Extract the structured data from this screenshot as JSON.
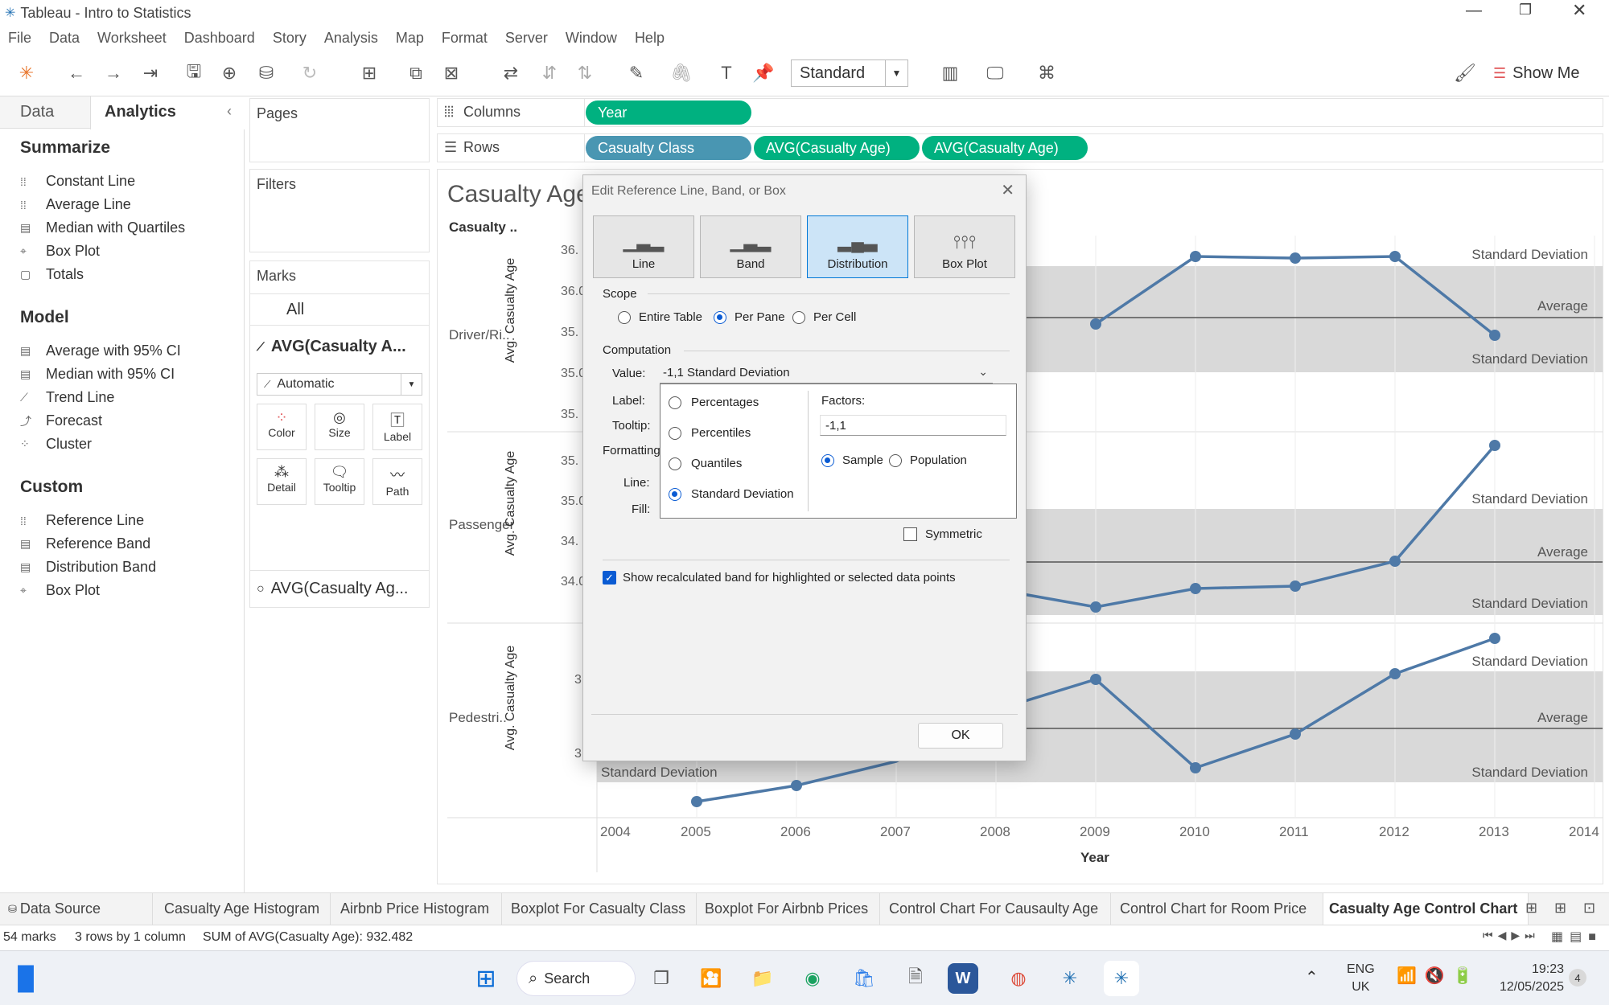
{
  "window": {
    "title": "Tableau - Intro to Statistics"
  },
  "menu": [
    "File",
    "Data",
    "Worksheet",
    "Dashboard",
    "Story",
    "Analysis",
    "Map",
    "Format",
    "Server",
    "Window",
    "Help"
  ],
  "toolbar": {
    "fit_select": "Standard",
    "show_me": "Show Me"
  },
  "left_pane": {
    "tab_data": "Data",
    "tab_analytics": "Analytics",
    "summarize": {
      "heading": "Summarize",
      "items": [
        "Constant Line",
        "Average Line",
        "Median with Quartiles",
        "Box Plot",
        "Totals"
      ]
    },
    "model": {
      "heading": "Model",
      "items": [
        "Average with 95% CI",
        "Median with 95% CI",
        "Trend Line",
        "Forecast",
        "Cluster"
      ]
    },
    "custom": {
      "heading": "Custom",
      "items": [
        "Reference Line",
        "Reference Band",
        "Distribution Band",
        "Box Plot"
      ]
    }
  },
  "cards": {
    "pages": "Pages",
    "filters": "Filters",
    "marks": "Marks",
    "marks_all": "All",
    "marks_measure1": "AVG(Casualty A...",
    "marks_type": "Automatic",
    "mark_buttons": [
      "Color",
      "Size",
      "Label",
      "Detail",
      "Tooltip",
      "Path"
    ],
    "marks_measure2": "AVG(Casualty Ag..."
  },
  "shelves": {
    "columns_label": "Columns",
    "rows_label": "Rows",
    "columns_pill": "Year",
    "rows_pills": [
      "Casualty Class",
      "AVG(Casualty Age)",
      "AVG(Casualty Age)"
    ]
  },
  "view": {
    "title": "Casualty Age",
    "header": "Casualty ..",
    "row_headers": [
      "Driver/Ri..",
      "Passenger",
      "Pedestri.."
    ],
    "axis_label": "Avg. Casualty Age",
    "ticks_pane1": [
      "36.",
      "36.0",
      "35.",
      "35.0",
      "35."
    ],
    "ticks_pane2": [
      "35.",
      "35.0",
      "34.",
      "34.0"
    ],
    "ticks_pane3": [
      "3",
      "3"
    ],
    "ref_std": "Standard Deviation",
    "ref_avg": "Average",
    "x_ticks": [
      "2004",
      "2005",
      "2006",
      "2007",
      "2008",
      "2009",
      "2010",
      "2011",
      "2012",
      "2013",
      "2014"
    ],
    "x_title": "Year"
  },
  "dialog": {
    "title": "Edit Reference Line, Band, or Box",
    "tabs": [
      "Line",
      "Band",
      "Distribution",
      "Box Plot"
    ],
    "scope_label": "Scope",
    "scope_options": [
      "Entire Table",
      "Per Pane",
      "Per Cell"
    ],
    "computation_label": "Computation",
    "value_label": "Value:",
    "value": "-1,1 Standard Deviation",
    "label_label": "Label:",
    "tooltip_label": "Tooltip:",
    "formatting_label": "Formatting",
    "line_label": "Line:",
    "fill_label": "Fill:",
    "dist_options": [
      "Percentages",
      "Percentiles",
      "Quantiles",
      "Standard Deviation"
    ],
    "factors_label": "Factors:",
    "factors_value": "-1,1",
    "sample": "Sample",
    "population": "Population",
    "symmetric": "Symmetric",
    "recalc": "Show recalculated band for highlighted or selected data points",
    "ok": "OK"
  },
  "sheet_tabs": [
    "Data Source",
    "Casualty Age Histogram",
    "Airbnb Price Histogram",
    "Boxplot For Casualty Class",
    "Boxplot For Airbnb Prices",
    "Control Chart For Causaulty Age",
    "Control Chart for Room Price",
    "Casualty Age Control Chart"
  ],
  "status": {
    "marks": "54 marks",
    "rows": "3 rows by 1 column",
    "sum": "SUM of AVG(Casualty Age): 932.482"
  },
  "taskbar": {
    "search": "Search",
    "lang1": "ENG",
    "lang2": "UK",
    "time": "19:23",
    "date": "12/05/2025",
    "notif": "4"
  },
  "colors": {
    "pill_blue": "#4996b2",
    "pill_green": "#00b180",
    "line": "#4e79a7",
    "band": "#d9d9d9"
  }
}
